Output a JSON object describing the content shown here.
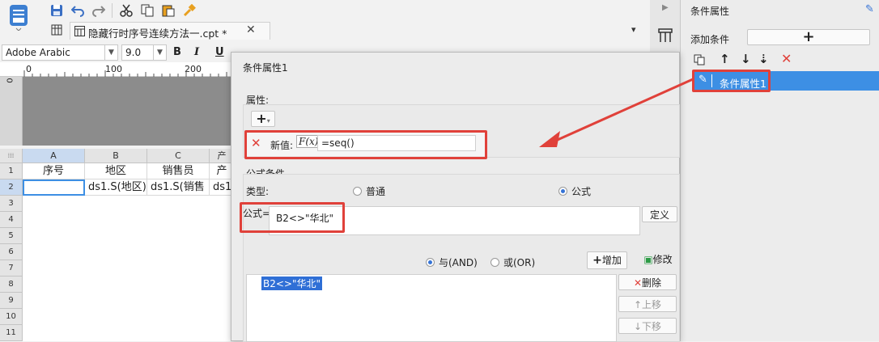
{
  "toolbar": {
    "icons": [
      "save-icon",
      "undo-icon",
      "redo-icon",
      "cut-icon",
      "copy-icon",
      "paste-icon",
      "format-painter-icon"
    ]
  },
  "tab": {
    "title": "隐藏行时序号连续方法一.cpt *"
  },
  "fontbar": {
    "font_name": "Adobe Arabic",
    "font_size": "9.0",
    "bold": "B",
    "italic": "I",
    "underline": "U"
  },
  "ruler": {
    "ticks": [
      "0",
      "100",
      "200"
    ]
  },
  "sheet": {
    "columns": [
      "A",
      "B",
      "C",
      "产"
    ],
    "rows": [
      "1",
      "2",
      "3",
      "4",
      "5",
      "6",
      "7",
      "8",
      "9",
      "10",
      "11"
    ],
    "row1": [
      "序号",
      "地区",
      "销售员",
      "产"
    ],
    "row2": [
      "",
      "ds1.S(地区)",
      "ds1.S(销售",
      "ds1"
    ]
  },
  "dialog": {
    "title": "条件属性1",
    "attr_label": "属性:",
    "new_value_label": "新值:",
    "fx_label": "F(x)",
    "new_value": "=seq()",
    "formula_cond_label": "公式条件",
    "type_label": "类型:",
    "type_normal": "普通",
    "type_formula": "公式",
    "formula_label": "公式=",
    "formula_value": "B2<>\"华北\"",
    "define_button": "定义",
    "and_label": "与(AND)",
    "or_label": "或(OR)",
    "add_button": "增加",
    "modify_button": "修改",
    "delete_button": "删除",
    "up_button": "上移",
    "down_button": "下移",
    "condition_list": [
      "B2<>\"华北\""
    ]
  },
  "right_panel": {
    "title": "条件属性",
    "add_condition_label": "添加条件",
    "items": [
      "条件属性1"
    ]
  },
  "colors": {
    "accent_red": "#e0413a",
    "selection_blue": "#3d8fe4",
    "text_highlight": "#2f6fd6"
  }
}
